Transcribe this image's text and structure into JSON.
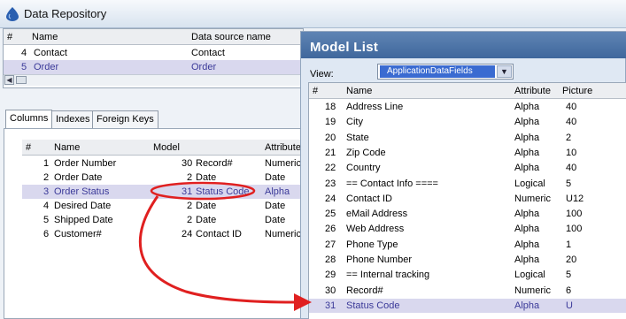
{
  "app": {
    "title": "Data Repository"
  },
  "top_table": {
    "columns": [
      "#",
      "Name",
      "Data source name"
    ],
    "rows": [
      {
        "num": "4",
        "name": "Contact",
        "source": "Contact",
        "selected": false
      },
      {
        "num": "5",
        "name": "Order",
        "source": "Order",
        "selected": true
      }
    ]
  },
  "tabs": [
    {
      "label": "Columns",
      "active": true
    },
    {
      "label": "Indexes",
      "active": false
    },
    {
      "label": "Foreign Keys",
      "active": false
    }
  ],
  "columns_table": {
    "headers": [
      "#",
      "Name",
      "Model",
      "Attribute"
    ],
    "rows": [
      {
        "num": "1",
        "name": "Order Number",
        "model_num": "30",
        "model_name": "Record#",
        "attr": "Numeric",
        "selected": false
      },
      {
        "num": "2",
        "name": "Order Date",
        "model_num": "2",
        "model_name": "Date",
        "attr": "Date",
        "selected": false
      },
      {
        "num": "3",
        "name": "Order Status",
        "model_num": "31",
        "model_name": "Status Code",
        "attr": "Alpha",
        "selected": true
      },
      {
        "num": "4",
        "name": "Desired Date",
        "model_num": "2",
        "model_name": "Date",
        "attr": "Date",
        "selected": false
      },
      {
        "num": "5",
        "name": "Shipped Date",
        "model_num": "2",
        "model_name": "Date",
        "attr": "Date",
        "selected": false
      },
      {
        "num": "6",
        "name": "Customer#",
        "model_num": "24",
        "model_name": "Contact ID",
        "attr": "Numeric",
        "selected": false
      }
    ]
  },
  "model_list": {
    "title": "Model List",
    "view_label": "View:",
    "view_value": "ApplicationDataFields",
    "headers": [
      "#",
      "Name",
      "Attribute",
      "Picture"
    ],
    "rows": [
      {
        "num": "18",
        "name": "Address Line",
        "attr": "Alpha",
        "pic": "40",
        "selected": false
      },
      {
        "num": "19",
        "name": "City",
        "attr": "Alpha",
        "pic": "40",
        "selected": false
      },
      {
        "num": "20",
        "name": "State",
        "attr": "Alpha",
        "pic": "2",
        "selected": false
      },
      {
        "num": "21",
        "name": "Zip Code",
        "attr": "Alpha",
        "pic": "10",
        "selected": false
      },
      {
        "num": "22",
        "name": "Country",
        "attr": "Alpha",
        "pic": "40",
        "selected": false
      },
      {
        "num": "23",
        "name": "== Contact Info ====",
        "attr": "Logical",
        "pic": "5",
        "selected": false
      },
      {
        "num": "24",
        "name": "Contact ID",
        "attr": "Numeric",
        "pic": "U12",
        "selected": false
      },
      {
        "num": "25",
        "name": "eMail Address",
        "attr": "Alpha",
        "pic": "100",
        "selected": false
      },
      {
        "num": "26",
        "name": "Web Address",
        "attr": "Alpha",
        "pic": "100",
        "selected": false
      },
      {
        "num": "27",
        "name": "Phone Type",
        "attr": "Alpha",
        "pic": "1",
        "selected": false
      },
      {
        "num": "28",
        "name": "Phone Number",
        "attr": "Alpha",
        "pic": "20",
        "selected": false
      },
      {
        "num": "29",
        "name": "== Internal tracking",
        "attr": "Logical",
        "pic": "5",
        "selected": false
      },
      {
        "num": "30",
        "name": "Record#",
        "attr": "Numeric",
        "pic": "6",
        "selected": false
      },
      {
        "num": "31",
        "name": "Status Code",
        "attr": "Alpha",
        "pic": "U",
        "selected": true
      }
    ]
  },
  "colors": {
    "selection": "#d9d8ee",
    "selection_text": "#3b3a99",
    "annotation": "#e02020",
    "model_titlebar": "#4a72a8"
  }
}
